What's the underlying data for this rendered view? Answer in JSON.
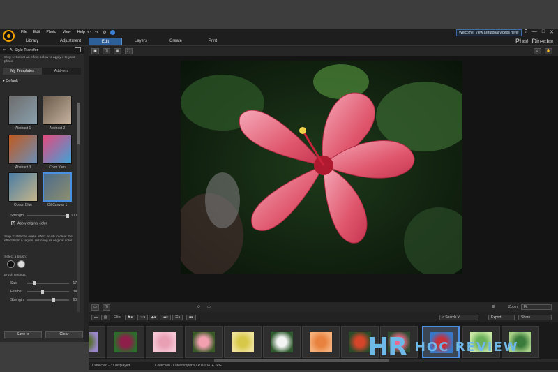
{
  "app": {
    "brand": "PhotoDirector"
  },
  "menu": [
    "File",
    "Edit",
    "Photo",
    "View",
    "Help"
  ],
  "welcome": "Welcome! View all tutorial videos here!",
  "modes": [
    "Library",
    "Adjustment",
    "Edit",
    "Layers",
    "Create",
    "Print"
  ],
  "panel": {
    "title": "AI Style Transfer",
    "step1": "Step 1: Select an effect below to apply it to your photo.",
    "tabs": [
      "My Templates",
      "Add-ons"
    ],
    "section": "Default",
    "tiles": [
      {
        "label": "Abstract 1",
        "colors": [
          "#6d6d6d",
          "#8aa0ad"
        ]
      },
      {
        "label": "Abstract 2",
        "colors": [
          "#6b5a4a",
          "#c7b4a1"
        ]
      },
      {
        "label": "Abstract 3",
        "colors": [
          "#c05a20",
          "#6b8eb8"
        ]
      },
      {
        "label": "Color Yarn",
        "colors": [
          "#e44a7e",
          "#3fa3d8"
        ]
      },
      {
        "label": "Ocean Blue",
        "colors": [
          "#4a7ca4",
          "#c5b58a"
        ]
      },
      {
        "label": "Oil Canvas 1",
        "colors": [
          "#4c6c8c",
          "#8e8e6e"
        ]
      }
    ],
    "strength_label": "Strength",
    "strength_value": "100",
    "apply_original": "Apply original color",
    "step2": "Step 2: Use the erase effect brush to clear the effect from a region, restoring its original color.",
    "select_brush": "Select a brush:",
    "brush_settings": "Brush settings:",
    "sliders": [
      {
        "label": "Size",
        "value": "17"
      },
      {
        "label": "Feather",
        "value": "34"
      },
      {
        "label": "Strength",
        "value": "60"
      }
    ],
    "save": "Save to",
    "clear": "Clear"
  },
  "viewer": {
    "zoom_label": "Zoom:",
    "zoom_value": "Fit"
  },
  "filmstrip": {
    "filter": "Filter",
    "search_placeholder": "Search",
    "export": "Export...",
    "share": "Share...",
    "thumbs": [
      {
        "colors": [
          "#5a6f3a",
          "#9a87c9"
        ]
      },
      {
        "colors": [
          "#8e1e4a",
          "#2c6c2c"
        ]
      },
      {
        "colors": [
          "#e9a0b5",
          "#f5c6d4"
        ]
      },
      {
        "colors": [
          "#f2a0b0",
          "#3b5a2a"
        ]
      },
      {
        "colors": [
          "#d8c84a",
          "#eee29a"
        ]
      },
      {
        "colors": [
          "#f4f4f4",
          "#2f5a2f"
        ]
      },
      {
        "colors": [
          "#e8823e",
          "#f5b07a"
        ]
      },
      {
        "colors": [
          "#d4452a",
          "#2a4a2a"
        ]
      },
      {
        "colors": [
          "#e96a8a",
          "#2f4a2f"
        ]
      },
      {
        "colors": [
          "#c8303a",
          "#3878c8"
        ]
      },
      {
        "colors": [
          "#6ab05a",
          "#c7e6a7"
        ]
      },
      {
        "colors": [
          "#3a7a3a",
          "#a8d088"
        ]
      }
    ]
  },
  "status": {
    "selection": "1 selected - 37 displayed",
    "path": "Collection / Latest imports / P1000414.JPG"
  },
  "watermark": {
    "hr": "HR",
    "rest": "HOC REVIEW"
  }
}
